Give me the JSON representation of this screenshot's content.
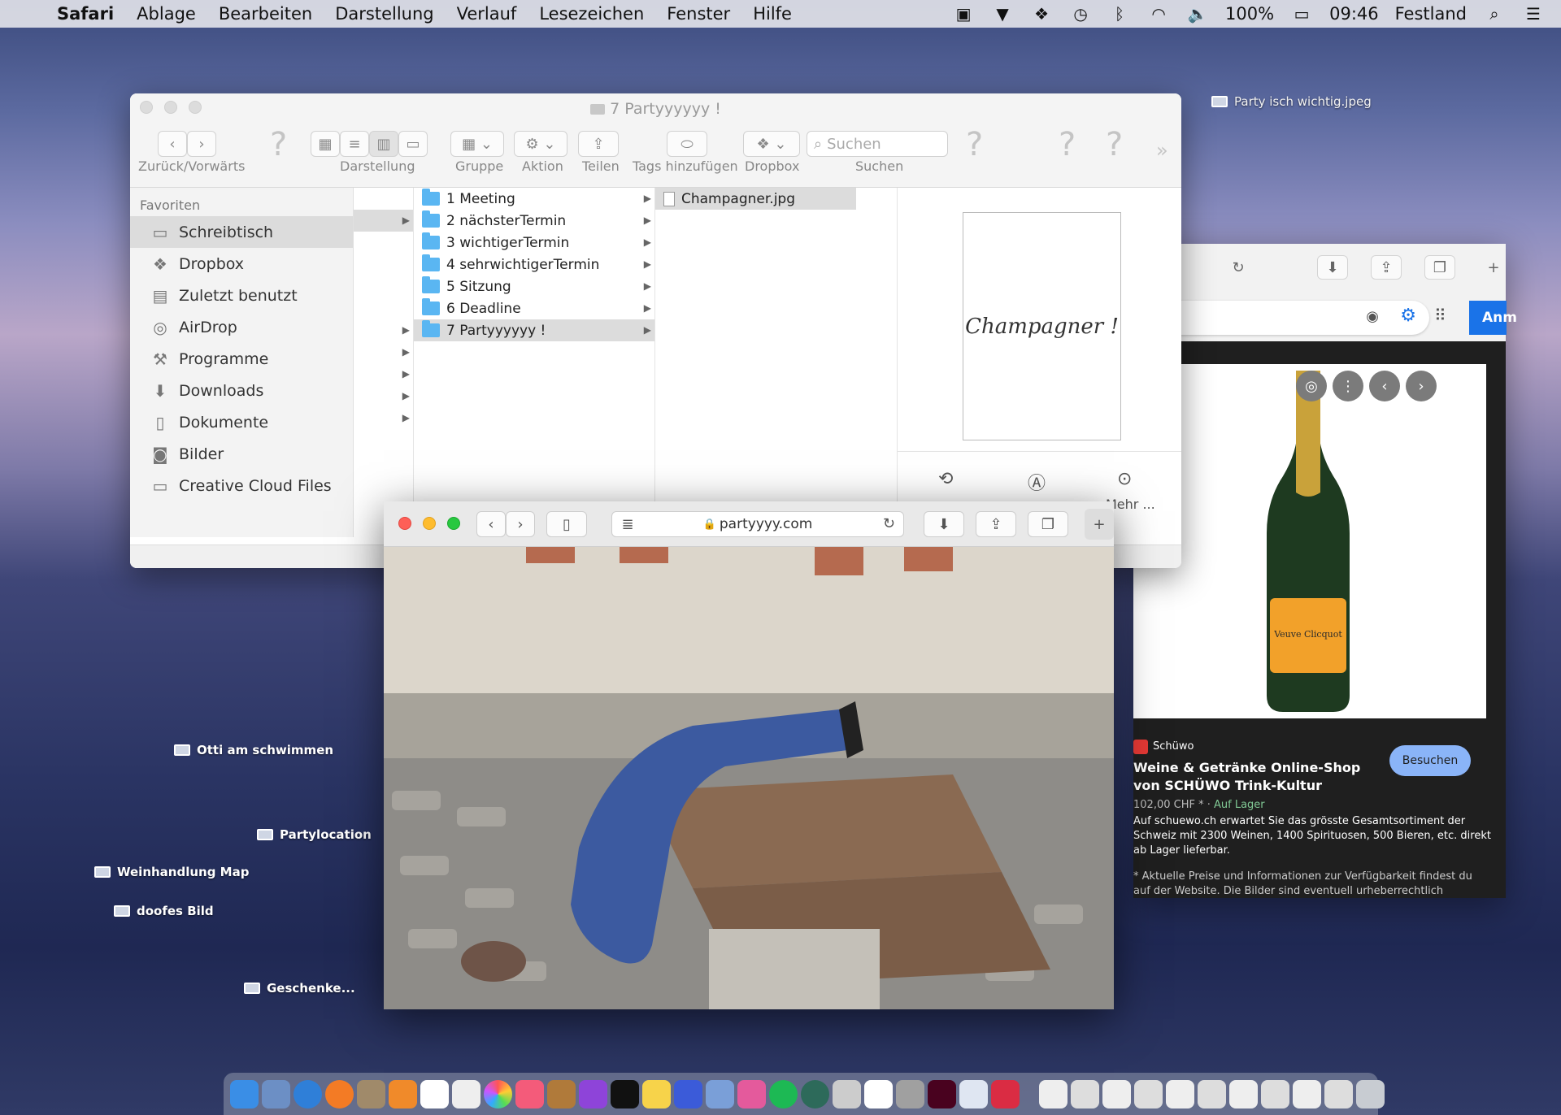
{
  "menubar": {
    "app_name": "Safari",
    "items": [
      "Ablage",
      "Bearbeiten",
      "Darstellung",
      "Verlauf",
      "Lesezeichen",
      "Fenster",
      "Hilfe"
    ],
    "battery": "100%",
    "time": "09:46",
    "location": "Festland"
  },
  "finder": {
    "title": "7 Partyyyyyy !",
    "toolbar": {
      "back_forward": "Zurück/Vorwärts",
      "view": "Darstellung",
      "group": "Gruppe",
      "action": "Aktion",
      "share": "Teilen",
      "tags": "Tags hinzufügen",
      "dropbox": "Dropbox",
      "search": "Suchen",
      "search_placeholder": "Suchen"
    },
    "sidebar": {
      "heading": "Favoriten",
      "items": [
        "Schreibtisch",
        "Dropbox",
        "Zuletzt benutzt",
        "AirDrop",
        "Programme",
        "Downloads",
        "Dokumente",
        "Bilder",
        "Creative Cloud Files"
      ]
    },
    "folders": [
      "1 Meeting",
      "2 nächsterTermin",
      "3 wichtigerTermin",
      "4 sehrwichtigerTermin",
      "5 Sitzung",
      "6 Deadline",
      "7 Partyyyyyy !"
    ],
    "files": [
      "Champagner.jpg"
    ],
    "preview_text": "Champagner !",
    "preview_more": "Mehr ..."
  },
  "google": {
    "merchant": "Schüwo",
    "title": "Weine & Getränke Online-Shop von SCHÜWO Trink-Kultur",
    "price": "102,00 CHF *",
    "stock": "Auf Lager",
    "desc": "Auf schuewo.ch erwartet Sie das grösste Gesamtsortiment der Schweiz mit 2300 Weinen, 1400 Spirituosen, 500 Bieren, etc. direkt ab Lager lieferbar.",
    "note": "* Aktuelle Preise und Informationen zur Verfügbarkeit findest du auf der Website. Die Bilder sind eventuell urheberrechtlich",
    "visit": "Besuchen",
    "button": "Anm",
    "bottle_label": "Veuve Clicquot"
  },
  "safari": {
    "url": "partyyyy.com"
  },
  "desktop": {
    "files": [
      "Party isch wichtig.jpeg",
      "Otti am schwimmen",
      "Partylocation",
      "Weinhandlung Map",
      "doofes Bild",
      "Geschenke..."
    ]
  },
  "colors": {
    "folder": "#5ab6f2",
    "selection": "#dcdcdc",
    "google_blue": "#1a73e8",
    "stock_green": "#81c995"
  }
}
